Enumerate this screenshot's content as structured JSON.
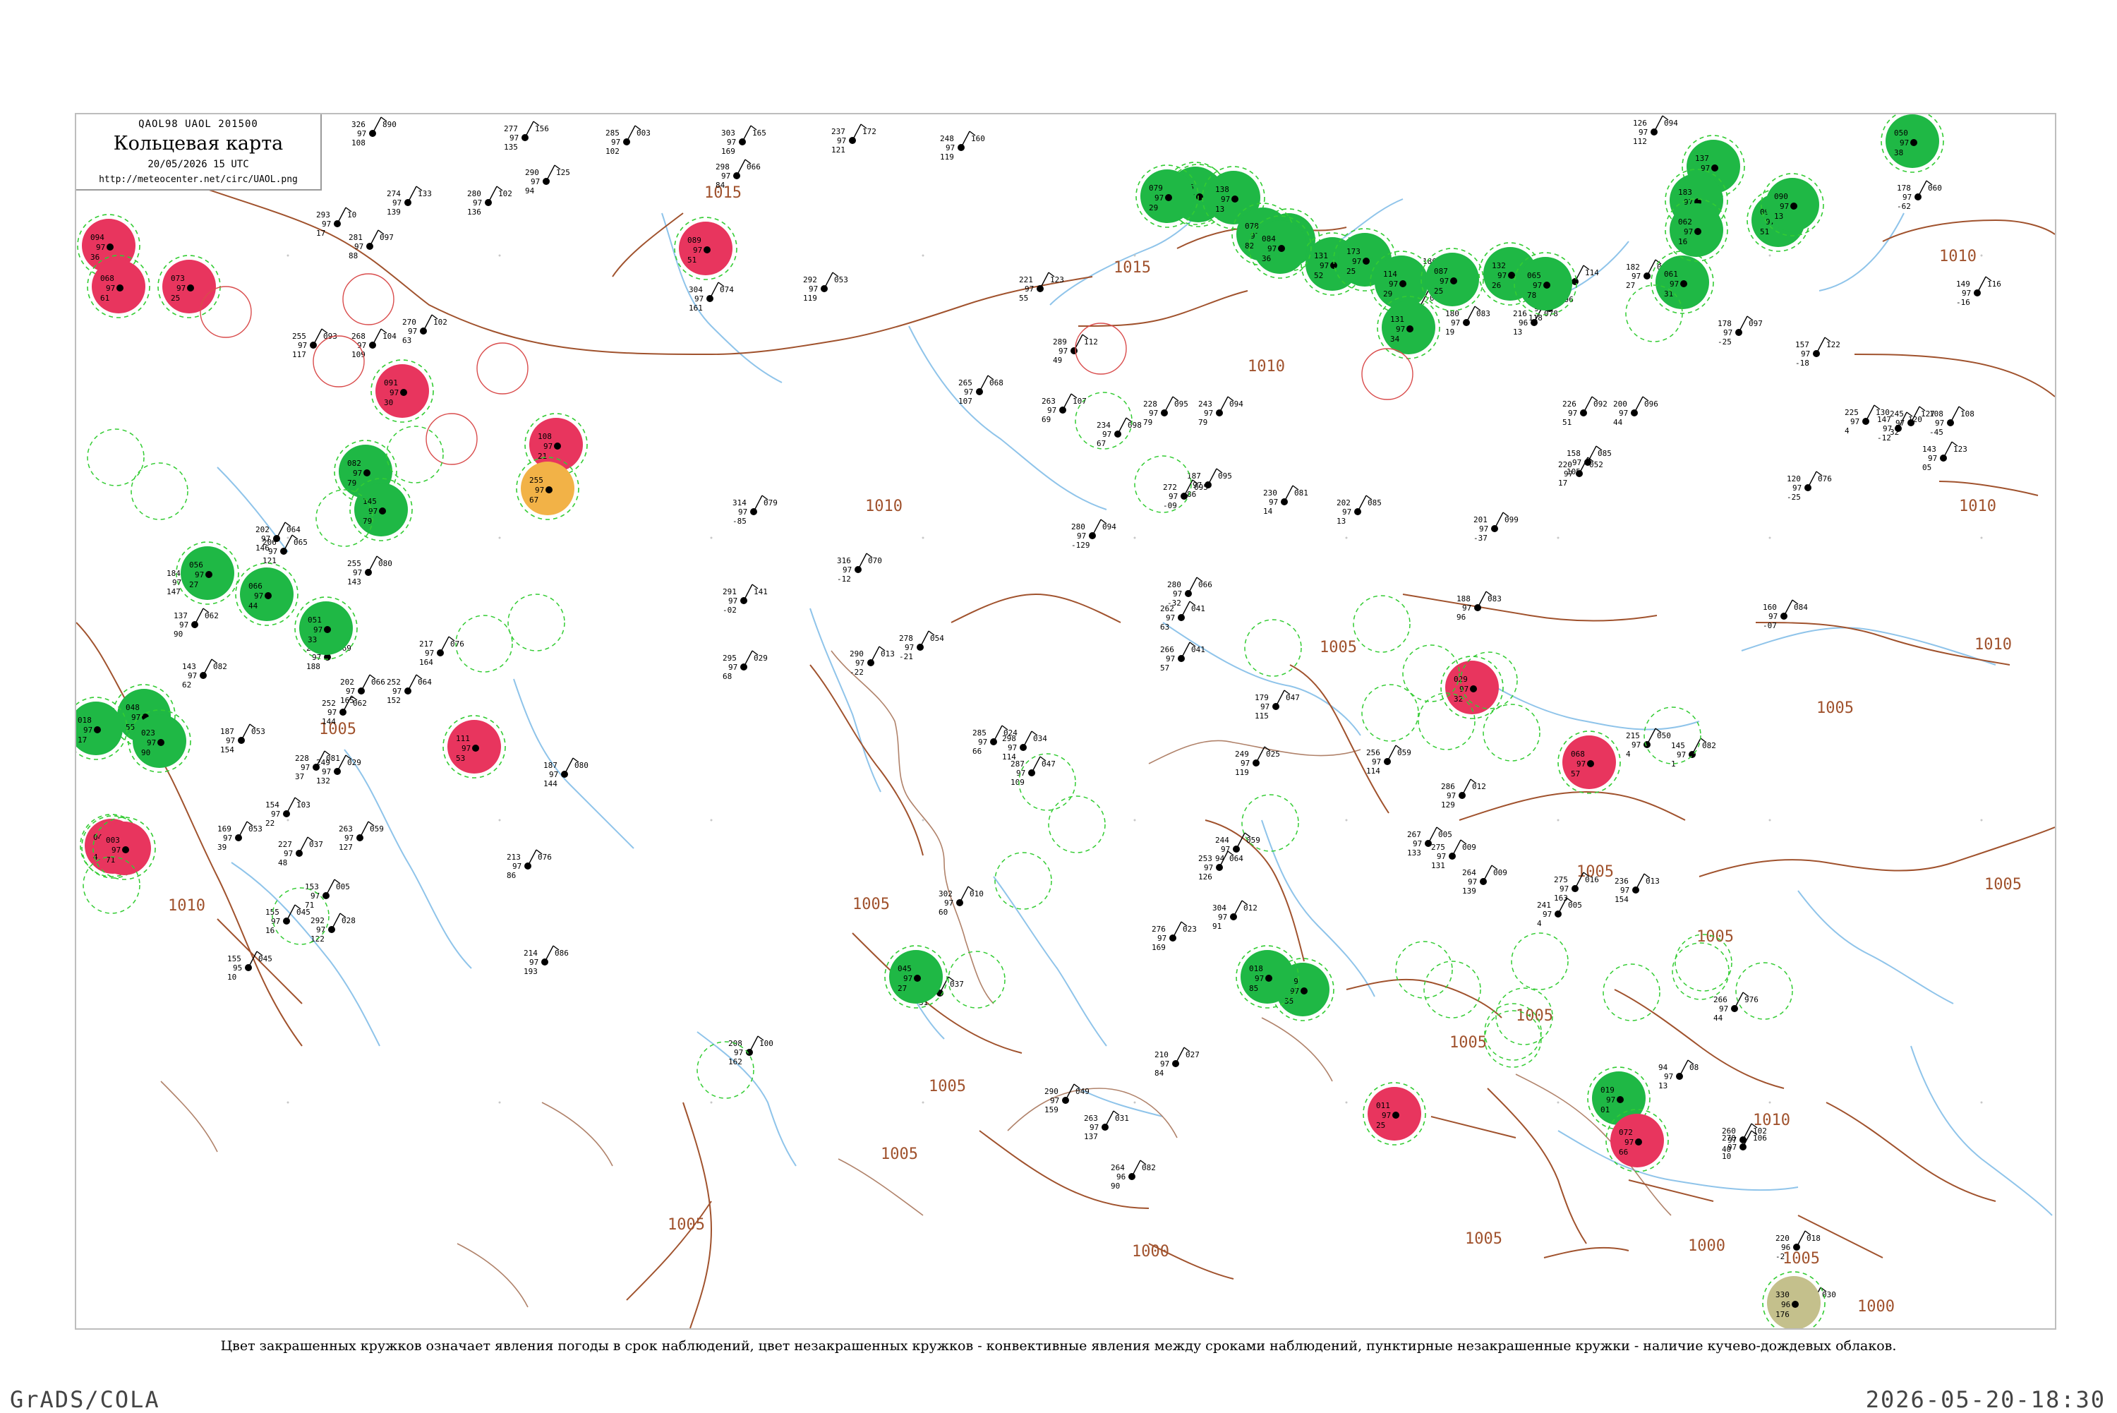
{
  "header": {
    "codes": "QAOL98  UAOL  201500",
    "title": "Кольцевая карта",
    "datetime": "20/05/2026 15 UTC",
    "url": "http://meteocenter.net/circ/UAOL.png"
  },
  "legend_caption": "Цвет закрашенных кружков означает явления погоды в срок наблюдений, цвет незакрашенных кружков - конвективные явления между сроками наблюдений, пунктирные незакрашенные кружки - наличие кучево-дождевых облаков.",
  "footer": {
    "left": "GrADS/COLA",
    "right": "2026-05-20-18:30"
  },
  "colors": {
    "isobar": "#a0522d",
    "river": "#8fc4ea",
    "rain_fill": "#1fb845",
    "thunder_fill": "#e8355e",
    "shower_fill": "#f2b247",
    "dust_fill": "#c4c08c",
    "cb_dashed": "#33cc33",
    "conv_open": "#d94c4c"
  },
  "isobar_labels": [
    "1015",
    "1015",
    "1010",
    "1010",
    "1005",
    "1005",
    "1010",
    "1010",
    "1010",
    "1005",
    "1005",
    "1005",
    "1005",
    "1005",
    "1005",
    "1005",
    "1010",
    "1005",
    "1000",
    "1005",
    "1000",
    "1000",
    "1005",
    "1005",
    "1010",
    "1005"
  ],
  "stations": [
    {
      "a": "326",
      "b": "97",
      "c": "108",
      "d": "890"
    },
    {
      "a": "277",
      "b": "97",
      "c": "135",
      "d": "156"
    },
    {
      "a": "285",
      "b": "97",
      "c": "102",
      "d": "003"
    },
    {
      "a": "303",
      "b": "97",
      "c": "169",
      "d": "165"
    },
    {
      "a": "237",
      "b": "97",
      "c": "121",
      "d": "172"
    },
    {
      "a": "248",
      "b": "97",
      "c": "119",
      "d": "160"
    },
    {
      "a": "290",
      "b": "97",
      "c": "94",
      "d": "125"
    },
    {
      "a": "298",
      "b": "97",
      "c": "84",
      "d": "066"
    },
    {
      "a": "281",
      "b": "97",
      "c": "88",
      "d": "097"
    },
    {
      "a": "293",
      "b": "97",
      "c": "17",
      "d": "10"
    },
    {
      "a": "274",
      "b": "97",
      "c": "139",
      "d": "133"
    },
    {
      "a": "280",
      "b": "97",
      "c": "136",
      "d": "102"
    },
    {
      "a": "268",
      "b": "97",
      "c": "109",
      "d": "104"
    },
    {
      "a": "255",
      "b": "97",
      "c": "117",
      "d": "093"
    },
    {
      "a": "270",
      "b": "97",
      "c": "63",
      "d": "102"
    },
    {
      "a": "304",
      "b": "97",
      "c": "161",
      "d": "074"
    },
    {
      "a": "292",
      "b": "97",
      "c": "119",
      "d": "053"
    },
    {
      "a": "265",
      "b": "97",
      "c": "107",
      "d": "068"
    },
    {
      "a": "221",
      "b": "97",
      "c": "55",
      "d": "123"
    },
    {
      "a": "289",
      "b": "97",
      "c": "49",
      "d": "112"
    },
    {
      "a": "263",
      "b": "97",
      "c": "69",
      "d": "107"
    },
    {
      "a": "234",
      "b": "97",
      "c": "67",
      "d": "098"
    },
    {
      "a": "228",
      "b": "97",
      "c": "79",
      "d": "095"
    },
    {
      "a": "243",
      "b": "97",
      "c": "79",
      "d": "094"
    },
    {
      "a": "187",
      "b": "97",
      "c": "86",
      "d": "095"
    },
    {
      "a": "230",
      "b": "97",
      "c": "14",
      "d": "081"
    },
    {
      "a": "202",
      "b": "97",
      "c": "13",
      "d": "085"
    },
    {
      "a": "201",
      "b": "97",
      "c": "-37",
      "d": "099"
    },
    {
      "a": "188",
      "b": "97",
      "c": "96",
      "d": "083"
    },
    {
      "a": "160",
      "b": "97",
      "c": "-07",
      "d": "084"
    },
    {
      "a": "143",
      "b": "97",
      "c": "05",
      "d": "123"
    },
    {
      "a": "157",
      "b": "97",
      "c": "-18",
      "d": "122"
    },
    {
      "a": "120",
      "b": "97",
      "c": "-25",
      "d": "076"
    },
    {
      "a": "178",
      "b": "97",
      "c": "-25",
      "d": "097"
    },
    {
      "a": "182",
      "b": "97",
      "c": "27",
      "d": "065"
    },
    {
      "a": "226",
      "b": "97",
      "c": "51",
      "d": "092"
    },
    {
      "a": "200",
      "b": "97",
      "c": "44",
      "d": "096"
    },
    {
      "a": "220",
      "b": "97",
      "c": "17",
      "d": "052"
    },
    {
      "a": "158",
      "b": "97",
      "c": "105",
      "d": "085"
    },
    {
      "a": "215",
      "b": "97",
      "c": "4",
      "d": "050"
    },
    {
      "a": "145",
      "b": "97",
      "c": "1",
      "d": "082"
    },
    {
      "a": "266",
      "b": "97",
      "c": "44",
      "d": "976"
    },
    {
      "a": "220",
      "b": "96",
      "c": "-2",
      "d": "018"
    },
    {
      "a": "326",
      "b": "96",
      "c": "112",
      "d": "030"
    },
    {
      "a": "244",
      "b": "97",
      "c": "31",
      "d": "037"
    },
    {
      "a": "302",
      "b": "97",
      "c": "60",
      "d": "010"
    },
    {
      "a": "208",
      "b": "97",
      "c": "162",
      "d": "100"
    },
    {
      "a": "264",
      "b": "96",
      "c": "90",
      "d": "082"
    },
    {
      "a": "263",
      "b": "97",
      "c": "137",
      "d": "031"
    },
    {
      "a": "290",
      "b": "97",
      "c": "159",
      "d": "049"
    },
    {
      "a": "210",
      "b": "97",
      "c": "84",
      "d": "027"
    },
    {
      "a": "276",
      "b": "97",
      "c": "169",
      "d": "023"
    },
    {
      "a": "304",
      "b": "97",
      "c": "91",
      "d": "012"
    },
    {
      "a": "249",
      "b": "97",
      "c": "119",
      "d": "025"
    },
    {
      "a": "253",
      "b": "97",
      "c": "126",
      "d": "064"
    },
    {
      "a": "244",
      "b": "97",
      "c": "94",
      "d": "059"
    },
    {
      "a": "187",
      "b": "97",
      "c": "144",
      "d": "080"
    },
    {
      "a": "263",
      "b": "97",
      "c": "127",
      "d": "059"
    },
    {
      "a": "213",
      "b": "97",
      "c": "86",
      "d": "076"
    },
    {
      "a": "214",
      "b": "97",
      "c": "193",
      "d": "086"
    },
    {
      "a": "155",
      "b": "97",
      "c": "16",
      "d": "045"
    },
    {
      "a": "155",
      "b": "95",
      "c": "10",
      "d": "045"
    },
    {
      "a": "169",
      "b": "97",
      "c": "39",
      "d": "053"
    },
    {
      "a": "154",
      "b": "97",
      "c": "22",
      "d": "103"
    },
    {
      "a": "227",
      "b": "97",
      "c": "48",
      "d": "037"
    },
    {
      "a": "153",
      "b": "97",
      "c": "71",
      "d": "005"
    },
    {
      "a": "292",
      "b": "97",
      "c": "122",
      "d": "028"
    },
    {
      "a": "252",
      "b": "97",
      "c": "152",
      "d": "064"
    },
    {
      "a": "228",
      "b": "97",
      "c": "37",
      "d": "081"
    },
    {
      "a": "249",
      "b": "97",
      "c": "132",
      "d": "029"
    },
    {
      "a": "252",
      "b": "97",
      "c": "144",
      "d": "062"
    },
    {
      "a": "187",
      "b": "97",
      "c": "154",
      "d": "053"
    },
    {
      "a": "137",
      "b": "97",
      "c": "90",
      "d": "062"
    },
    {
      "a": "143",
      "b": "97",
      "c": "62",
      "d": "082"
    },
    {
      "a": "202",
      "b": "97",
      "c": "146",
      "d": "064"
    },
    {
      "a": "206",
      "b": "97",
      "c": "121",
      "d": "065"
    },
    {
      "a": "184",
      "b": "97",
      "c": "147",
      "d": "066"
    },
    {
      "a": "255",
      "b": "97",
      "c": "143",
      "d": "080"
    },
    {
      "a": "217",
      "b": "97",
      "c": "164",
      "d": "076"
    },
    {
      "a": "237",
      "b": "97",
      "c": "188",
      "d": "069"
    },
    {
      "a": "202",
      "b": "97",
      "c": "165",
      "d": "066"
    },
    {
      "a": "295",
      "b": "97",
      "c": "68",
      "d": "029"
    },
    {
      "a": "290",
      "b": "97",
      "c": "-22",
      "d": "013"
    },
    {
      "a": "278",
      "b": "97",
      "c": "-21",
      "d": "054"
    },
    {
      "a": "285",
      "b": "97",
      "c": "66",
      "d": "024"
    },
    {
      "a": "287",
      "b": "97",
      "c": "109",
      "d": "047"
    },
    {
      "a": "298",
      "b": "97",
      "c": "114",
      "d": "034"
    },
    {
      "a": "316",
      "b": "97",
      "c": "-12",
      "d": "070"
    },
    {
      "a": "291",
      "b": "97",
      "c": "-02",
      "d": "141"
    },
    {
      "a": "314",
      "b": "97",
      "c": "-85",
      "d": "079"
    },
    {
      "a": "280",
      "b": "97",
      "c": "-129",
      "d": "094"
    },
    {
      "a": "272",
      "b": "97",
      "c": "-09",
      "d": "095"
    },
    {
      "a": "280",
      "b": "97",
      "c": "-32",
      "d": "066"
    },
    {
      "a": "262",
      "b": "97",
      "c": "63",
      "d": "041"
    },
    {
      "a": "266",
      "b": "97",
      "c": "57",
      "d": "041"
    },
    {
      "a": "179",
      "b": "97",
      "c": "115",
      "d": "047"
    },
    {
      "a": "256",
      "b": "97",
      "c": "114",
      "d": "059"
    },
    {
      "a": "286",
      "b": "97",
      "c": "129",
      "d": "012"
    },
    {
      "a": "267",
      "b": "97",
      "c": "133",
      "d": "005"
    },
    {
      "a": "275",
      "b": "97",
      "c": "131",
      "d": "009"
    },
    {
      "a": "264",
      "b": "97",
      "c": "139",
      "d": "009"
    },
    {
      "a": "275",
      "b": "97",
      "c": "163",
      "d": "016"
    },
    {
      "a": "236",
      "b": "97",
      "c": "154",
      "d": "013"
    },
    {
      "a": "241",
      "b": "97",
      "c": "4",
      "d": "005"
    },
    {
      "a": "94",
      "b": "97",
      "c": "13",
      "d": "08"
    },
    {
      "a": "260",
      "b": "97",
      "c": "40",
      "d": "102"
    },
    {
      "a": "270",
      "b": "97",
      "c": "10",
      "d": "106"
    },
    {
      "a": "108",
      "b": "97",
      "c": "-45",
      "d": "108"
    },
    {
      "a": "147",
      "b": "97",
      "c": "-12",
      "d": "120"
    },
    {
      "a": "245",
      "b": "97",
      "c": "32",
      "d": "127"
    },
    {
      "a": "225",
      "b": "97",
      "c": "4",
      "d": "130"
    },
    {
      "a": "209",
      "b": "97",
      "c": "27",
      "d": "088"
    },
    {
      "a": "186",
      "b": "97",
      "c": "104",
      "d": "127"
    },
    {
      "a": "180",
      "b": "97",
      "c": "19",
      "d": "083"
    },
    {
      "a": "216",
      "b": "96",
      "c": "13",
      "d": "078"
    },
    {
      "a": "148",
      "b": "97",
      "c": "118",
      "d": "096"
    },
    {
      "a": "130",
      "b": "97",
      "c": "12",
      "d": "114"
    },
    {
      "a": "126",
      "b": "97",
      "c": "112",
      "d": "094"
    },
    {
      "a": "178",
      "b": "97",
      "c": "-62",
      "d": "060"
    },
    {
      "a": "149",
      "b": "97",
      "c": "-16",
      "d": "116"
    }
  ],
  "circles": [
    {
      "type": "rain",
      "a": "082",
      "b": "97",
      "c": "79"
    },
    {
      "type": "rain",
      "a": "145",
      "b": "97",
      "c": "79"
    },
    {
      "type": "rain",
      "a": "130",
      "b": "97",
      "c": "12"
    },
    {
      "type": "rain",
      "a": "126",
      "b": "97",
      "c": "12"
    },
    {
      "type": "rain",
      "a": "138",
      "b": "97",
      "c": "13"
    },
    {
      "type": "rain",
      "a": "127",
      "b": "97",
      "c": "14"
    },
    {
      "type": "rain",
      "a": "131",
      "b": "97",
      "c": "52"
    },
    {
      "type": "rain",
      "a": "173",
      "b": "97",
      "c": "25"
    },
    {
      "type": "rain",
      "a": "114",
      "b": "97",
      "c": "29"
    },
    {
      "type": "rain",
      "a": "087",
      "b": "97",
      "c": "25"
    },
    {
      "type": "rain",
      "a": "131",
      "b": "97",
      "c": "34"
    },
    {
      "type": "rain",
      "a": "132",
      "b": "97",
      "c": "26"
    },
    {
      "type": "rain",
      "a": "065",
      "b": "97",
      "c": "78"
    },
    {
      "type": "rain",
      "a": "061",
      "b": "97",
      "c": "31"
    },
    {
      "type": "rain",
      "a": "137",
      "b": "97",
      "c": "45"
    },
    {
      "type": "rain",
      "a": "183",
      "b": "97",
      "c": "46"
    },
    {
      "type": "rain",
      "a": "062",
      "b": "97",
      "c": "16"
    },
    {
      "type": "rain",
      "a": "094",
      "b": "97",
      "c": "51"
    },
    {
      "type": "rain",
      "a": "090",
      "b": "97",
      "c": "13"
    },
    {
      "type": "rain",
      "a": "078",
      "b": "97",
      "c": "82"
    },
    {
      "type": "rain",
      "a": "050",
      "b": "97",
      "c": "38"
    },
    {
      "type": "rain",
      "a": "079",
      "b": "97",
      "c": "29"
    },
    {
      "type": "rain",
      "a": "084",
      "b": "97",
      "c": "36"
    },
    {
      "type": "rain",
      "a": "066",
      "b": "97",
      "c": "44"
    },
    {
      "type": "rain",
      "a": "051",
      "b": "97",
      "c": "33"
    },
    {
      "type": "rain",
      "a": "056",
      "b": "97",
      "c": "27"
    },
    {
      "type": "rain",
      "a": "049",
      "b": "97",
      "c": "35"
    },
    {
      "type": "rain",
      "a": "018",
      "b": "97",
      "c": "85"
    },
    {
      "type": "rain",
      "a": "045",
      "b": "97",
      "c": "27"
    },
    {
      "type": "rain",
      "a": "048",
      "b": "97",
      "c": "55"
    },
    {
      "type": "rain",
      "a": "023",
      "b": "97",
      "c": "90"
    },
    {
      "type": "rain",
      "a": "018",
      "b": "97",
      "c": "17"
    },
    {
      "type": "rain",
      "a": "019",
      "b": "97",
      "c": "01"
    },
    {
      "type": "thunder",
      "a": "094",
      "b": "97",
      "c": "36"
    },
    {
      "type": "thunder",
      "a": "068",
      "b": "97",
      "c": "61"
    },
    {
      "type": "thunder",
      "a": "073",
      "b": "97",
      "c": "25"
    },
    {
      "type": "thunder",
      "a": "091",
      "b": "97",
      "c": "30"
    },
    {
      "type": "thunder",
      "a": "108",
      "b": "97",
      "c": "21"
    },
    {
      "type": "thunder",
      "a": "111",
      "b": "97",
      "c": "53"
    },
    {
      "type": "thunder",
      "a": "089",
      "b": "97",
      "c": "51"
    },
    {
      "type": "thunder",
      "a": "029",
      "b": "97",
      "c": "32"
    },
    {
      "type": "thunder",
      "a": "068",
      "b": "97",
      "c": "57"
    },
    {
      "type": "thunder",
      "a": "011",
      "b": "97",
      "c": "25"
    },
    {
      "type": "thunder",
      "a": "072",
      "b": "97",
      "c": "66"
    },
    {
      "type": "thunder",
      "a": "050",
      "b": "97",
      "c": "45"
    },
    {
      "type": "thunder",
      "a": "043",
      "b": "97",
      "c": "41"
    },
    {
      "type": "thunder",
      "a": "003",
      "b": "97",
      "c": "71"
    },
    {
      "type": "shower",
      "a": "255",
      "b": "97",
      "c": "67"
    },
    {
      "type": "dust",
      "a": "330",
      "b": "96",
      "c": "176"
    }
  ]
}
